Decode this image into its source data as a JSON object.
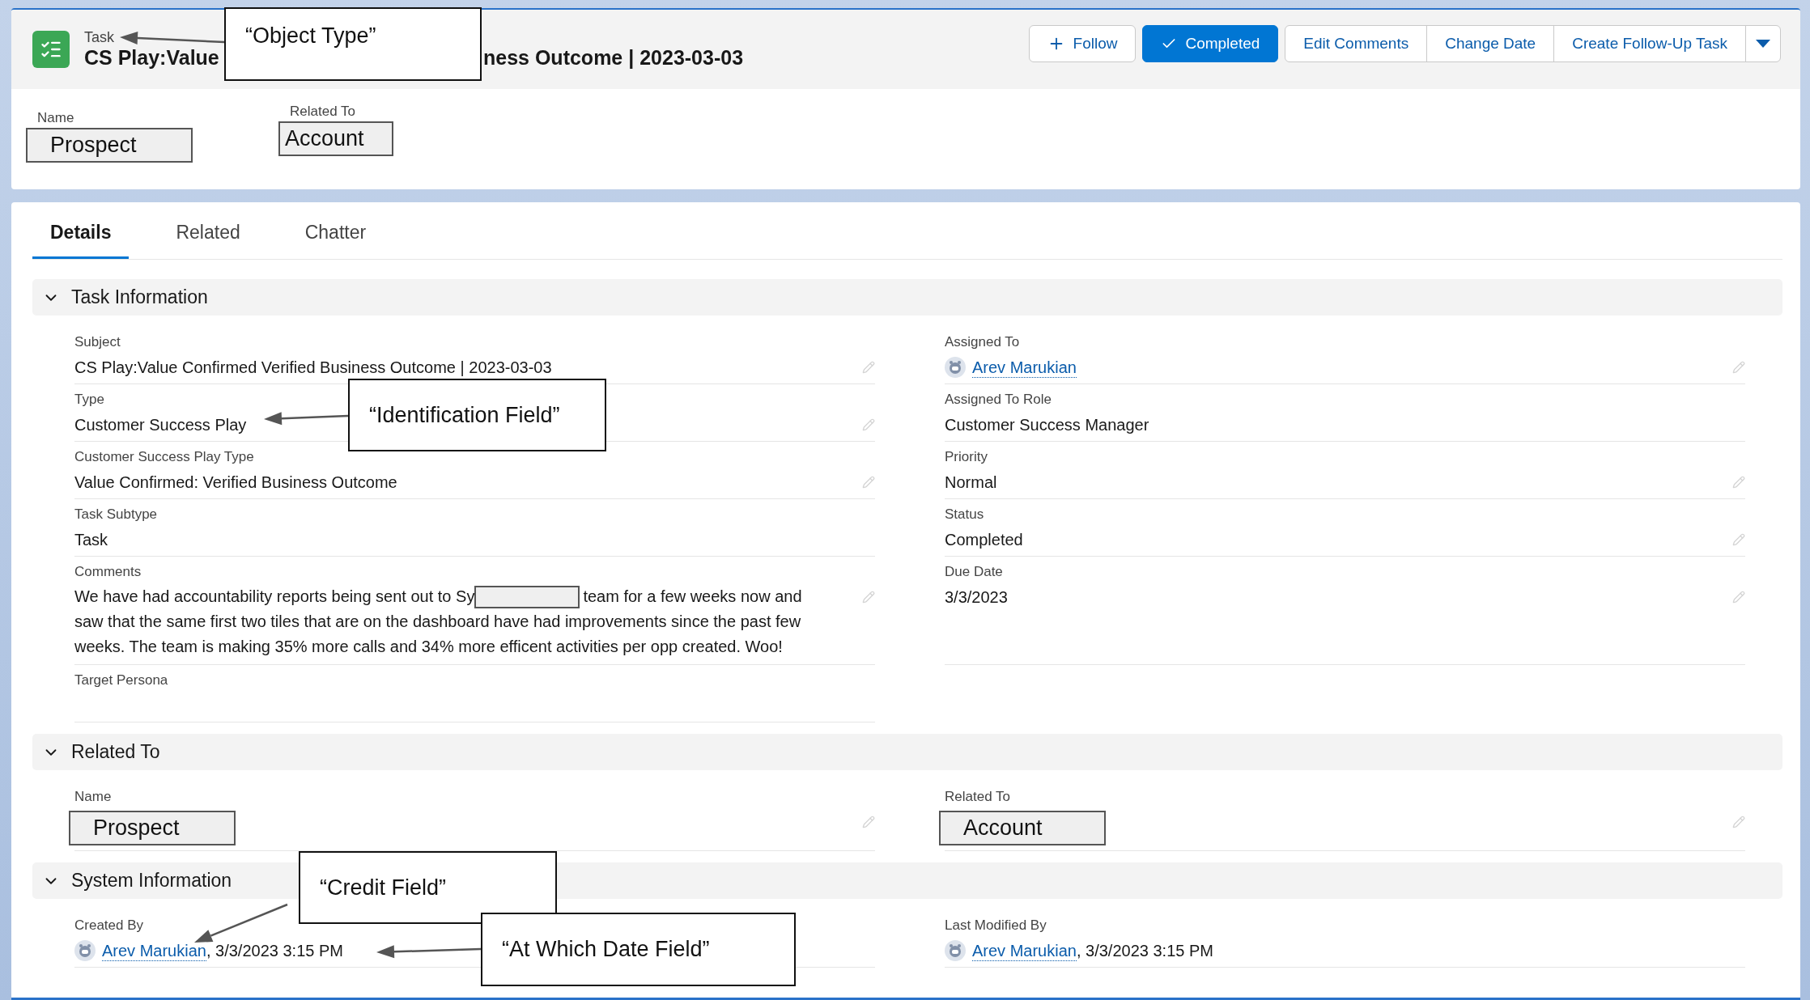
{
  "header": {
    "object_type": "Task",
    "title_start": "CS Play:Value",
    "title_end": "ness Outcome | 2023-03-03",
    "actions": [
      {
        "label": "Follow",
        "kind": "add"
      },
      {
        "label": "Completed",
        "kind": "brand"
      },
      {
        "label": "Edit Comments",
        "kind": "plain"
      },
      {
        "label": "Change Date",
        "kind": "plain"
      },
      {
        "label": "Create Follow-Up Task",
        "kind": "plain"
      },
      {
        "kind": "menu"
      }
    ],
    "highlights": [
      {
        "label": "Name",
        "value": "Prospect"
      },
      {
        "label": "Related To",
        "value": "Account"
      }
    ]
  },
  "tabs": [
    {
      "label": "Details",
      "selected": true
    },
    {
      "label": "Related",
      "selected": false
    },
    {
      "label": "Chatter",
      "selected": false
    }
  ],
  "sections": [
    {
      "title": "Task Information",
      "expanded": true,
      "left": [
        {
          "label": "Subject",
          "kind": "text",
          "value": "CS Play:Value Confirmed Verified Business Outcome | 2023-03-03",
          "editable": true
        },
        {
          "label": "Type",
          "kind": "text",
          "value": "Customer Success Play",
          "editable": true
        },
        {
          "label": "Customer Success Play Type",
          "kind": "text",
          "value": "Value Confirmed: Verified Business Outcome",
          "editable": true
        },
        {
          "label": "Task Subtype",
          "kind": "text",
          "value": "Task",
          "editable": false
        },
        {
          "label": "Comments",
          "kind": "comment",
          "before": "We have had accountability reports being sent out to Sy",
          "after": "team for a few weeks now and",
          "rest": "saw that the same first two tiles that are on the dashboard have had improvements since the past few weeks. The team is making 35% more calls and 34% more efficent activities per opp created. Woo!",
          "editable": true
        },
        {
          "label": "Target Persona",
          "kind": "text",
          "editable": false
        }
      ],
      "right": [
        {
          "label": "Assigned To",
          "kind": "user",
          "value": "Arev Marukian",
          "editable": true
        },
        {
          "label": "Assigned To Role",
          "kind": "text",
          "value": "Customer Success Manager",
          "editable": false
        },
        {
          "label": "Priority",
          "kind": "text",
          "value": "Normal",
          "editable": true
        },
        {
          "label": "Status",
          "kind": "text",
          "value": "Completed",
          "editable": true
        },
        {
          "label": "Due Date",
          "kind": "text",
          "value": "3/3/2023",
          "editable": true
        }
      ]
    },
    {
      "title": "Related To",
      "expanded": true,
      "left": [
        {
          "label": "Name",
          "kind": "masked",
          "value": "Prospect",
          "editable": true
        }
      ],
      "right": [
        {
          "label": "Related To",
          "kind": "masked",
          "value": "Account",
          "editable": true
        }
      ]
    },
    {
      "title": "System Information",
      "expanded": true,
      "left": [
        {
          "label": "Created By",
          "kind": "user",
          "value": "Arev Marukian",
          "suffix": ", 3/3/2023 3:15 PM",
          "editable": false
        }
      ],
      "right": [
        {
          "label": "Last Modified By",
          "kind": "user",
          "value": "Arev Marukian",
          "suffix": ", 3/3/2023 3:15 PM",
          "editable": false
        }
      ]
    }
  ],
  "annotations": [
    {
      "text": "“Object Type”"
    },
    {
      "text": "“Identification Field”"
    },
    {
      "text": "“Credit Field”"
    },
    {
      "text": "“At Which Date Field”"
    }
  ]
}
